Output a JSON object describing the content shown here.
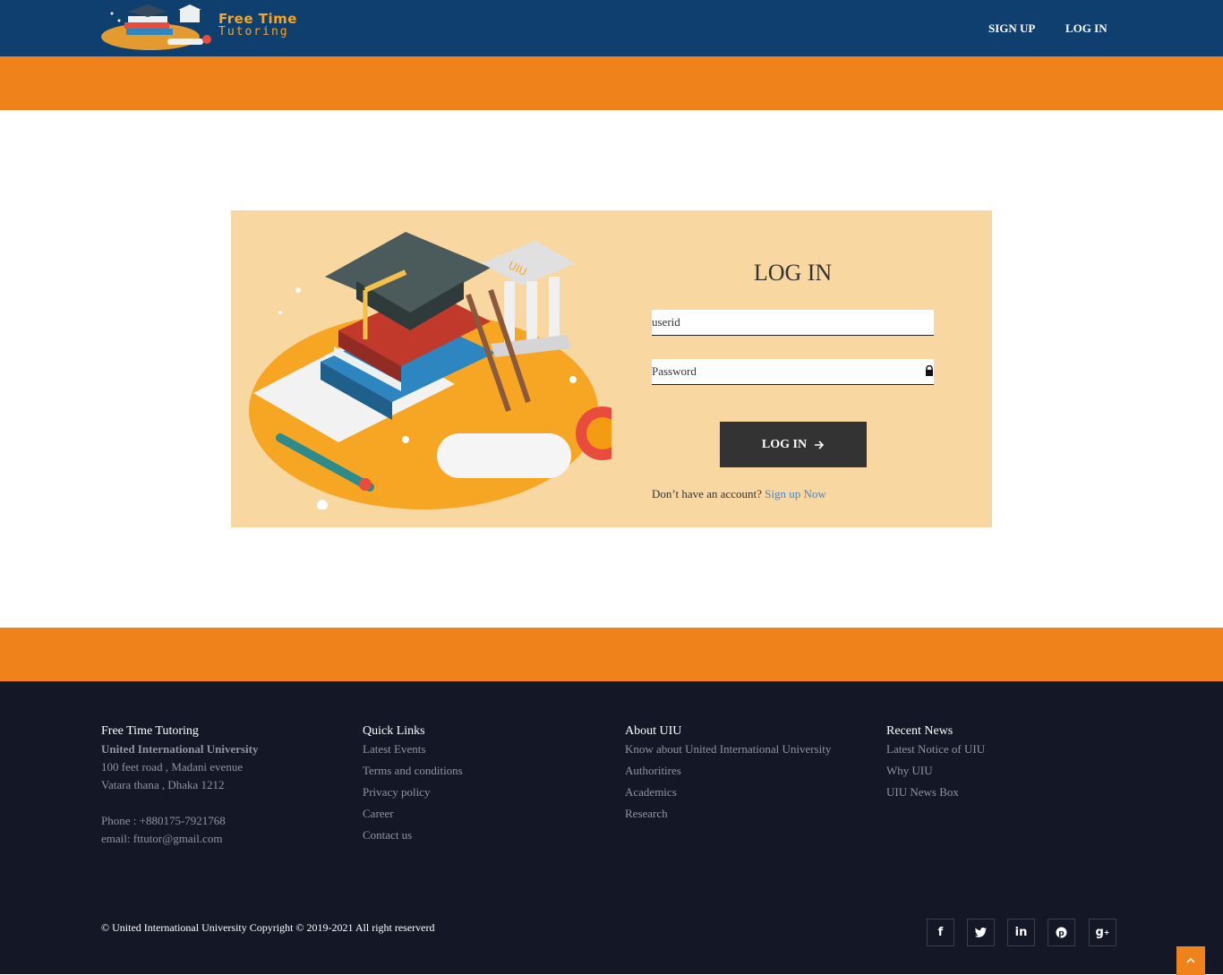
{
  "header": {
    "logo_line1": "Free Time",
    "logo_line2": "Tutoring",
    "nav": [
      {
        "label": "SIGN UP"
      },
      {
        "label": "LOG IN"
      }
    ]
  },
  "login": {
    "title": "LOG IN",
    "userid_placeholder": "userid",
    "password_placeholder": "Password",
    "button_label": "LOG IN",
    "no_account_text": "Don’t have an account?",
    "signup_link": "Sign up Now",
    "illustration_badge": "UIU"
  },
  "footer": {
    "brand": {
      "title": "Free Time Tutoring",
      "university": "United International University",
      "address1": "100 feet road , Madani evenue",
      "address2": "Vatara thana , Dhaka 1212",
      "phone": "Phone : +880175-7921768",
      "email": "email: fttutor@gmail.com"
    },
    "quick_links": {
      "title": "Quick Links",
      "items": [
        "Latest Events",
        "Terms and conditions",
        "Privacy policy",
        "Career",
        "Contact us"
      ]
    },
    "about": {
      "title": "About UIU",
      "items": [
        "Know about United International University",
        "Authoritires",
        "Academics",
        "Research"
      ]
    },
    "news": {
      "title": "Recent News",
      "items": [
        "Latest Notice of UIU",
        "Why UIU",
        "UIU News Box"
      ]
    },
    "copyright": "© United International University Copyright © 2019-2021 All right reserverd",
    "social": [
      "facebook-icon",
      "twitter-icon",
      "linkedin-icon",
      "pinterest-icon",
      "google-plus-icon"
    ]
  },
  "colors": {
    "header_bg": "#0e3f6f",
    "accent_orange": "#f0821c",
    "card_bg": "#f9d7a0",
    "button_bg": "#333333",
    "footer_bg": "#131726",
    "link_blue": "#4a86c8"
  }
}
